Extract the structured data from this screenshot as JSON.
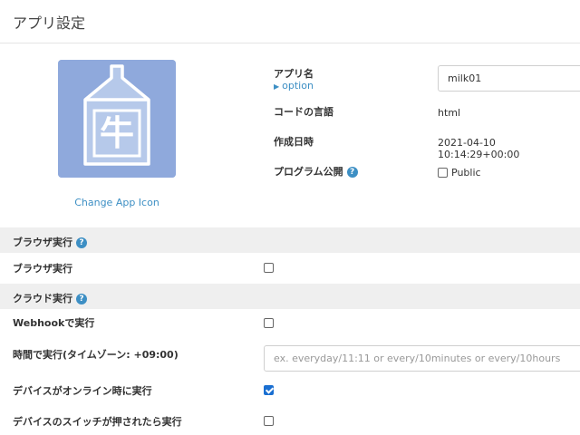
{
  "page": {
    "title": "アプリ設定"
  },
  "app": {
    "icon_char": "牛",
    "change_icon_label": "Change App Icon",
    "name_label": "アプリ名",
    "option_label": "option",
    "name_value": "milk01",
    "language_label": "コードの言語",
    "language_value": "html",
    "created_label": "作成日時",
    "created_value": "2021-04-10 10:14:29+00:00",
    "publish_label": "プログラム公開",
    "public_label": "Public",
    "public_checked": false
  },
  "browser_section": {
    "title": "ブラウザ実行",
    "run_label": "ブラウザ実行",
    "run_checked": false
  },
  "cloud_section": {
    "title": "クラウド実行",
    "webhook_label": "Webhookで実行",
    "webhook_checked": false,
    "schedule_label": "時間で実行(タイムゾーン: +09:00)",
    "schedule_placeholder": "ex. everyday/11:11 or every/10minutes or every/10hours",
    "online_label": "デバイスがオンライン時に実行",
    "online_checked": true,
    "switch_label": "デバイスのスイッチが押されたら実行",
    "switch_checked": false
  },
  "colors": {
    "accent": "#3d8fc4",
    "icon_background": "#8fa9dc",
    "icon_tag": "#b6c9ea",
    "section_band": "#efefef",
    "checkbox_checked": "#1a6fd1"
  },
  "icons": {
    "help": "question-circle-icon",
    "option_caret": "caret-right-icon"
  }
}
